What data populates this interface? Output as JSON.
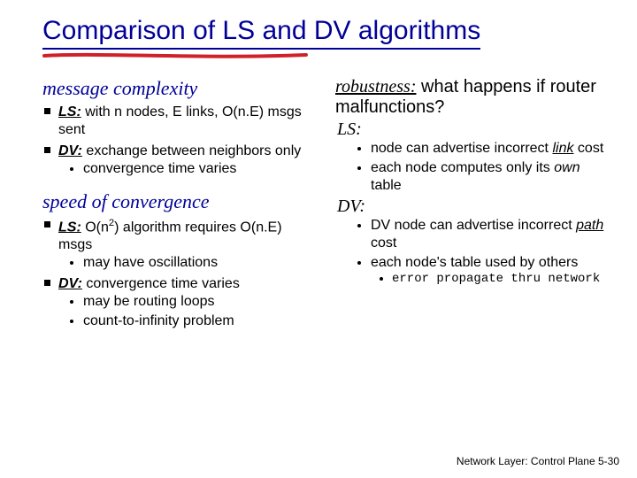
{
  "title": "Comparison of LS and DV algorithms",
  "left": {
    "sec1": {
      "heading": "message complexity",
      "li1_pre": "LS:",
      "li1_rest": " with n nodes, E links, O(n.E) msgs sent",
      "li2_pre": "DV:",
      "li2_rest": " exchange between neighbors only",
      "li2_sub1": "convergence time varies"
    },
    "sec2": {
      "heading": "speed of convergence",
      "li1_pre": "LS:",
      "li1_mid": " O(n",
      "li1_sup": "2",
      "li1_rest": ") algorithm requires O(n.E) msgs",
      "li1_sub1": "may have oscillations",
      "li2_pre": "DV:",
      "li2_rest": " convergence time varies",
      "li2_sub1": "may be routing loops",
      "li2_sub2": "count-to-infinity problem"
    }
  },
  "right": {
    "heading_u": "robustness:",
    "heading_rest": " what happens if router malfunctions?",
    "ls_label": "LS:",
    "ls_li1_a": "node can advertise incorrect ",
    "ls_li1_link": "link",
    "ls_li1_b": " cost",
    "ls_li2_a": "each node computes only its ",
    "ls_li2_own": "own",
    "ls_li2_b": " table",
    "dv_label": "DV:",
    "dv_li1_a": "DV node can advertise incorrect ",
    "dv_li1_path": "path",
    "dv_li1_b": " cost",
    "dv_li2": "each node's table used by others",
    "dv_li2_sub": "error propagate thru network"
  },
  "footer": "Network Layer: Control Plane  5-30"
}
